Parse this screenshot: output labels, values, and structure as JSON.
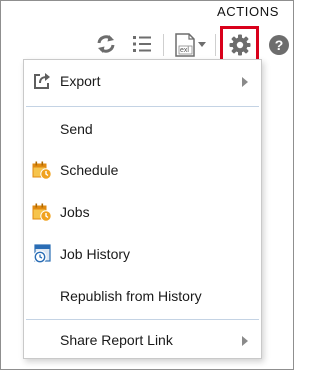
{
  "caption": "ACTIONS",
  "toolbar": {
    "refresh_icon": "refresh-icon",
    "list_icon": "list-icon",
    "export_icon": "export-file-icon",
    "actions_icon": "gear-icon",
    "help_icon": "help-icon",
    "export_file_badge": "exl",
    "help_glyph": "?"
  },
  "menu": {
    "items": [
      {
        "label": "Export",
        "icon": "export-icon",
        "has_submenu": true
      },
      {
        "label": "Send",
        "icon": ""
      },
      {
        "label": "Schedule",
        "icon": "schedule-icon"
      },
      {
        "label": "Jobs",
        "icon": "jobs-icon"
      },
      {
        "label": "Job History",
        "icon": "job-history-icon"
      },
      {
        "label": "Republish from History",
        "icon": ""
      },
      {
        "label": "Share Report Link",
        "icon": "",
        "has_submenu": true
      }
    ]
  },
  "colors": {
    "highlight": "#d9001b",
    "icon_gray": "#6d6d6d",
    "schedule_orange": "#f0a21f",
    "history_blue": "#2a6db5"
  }
}
